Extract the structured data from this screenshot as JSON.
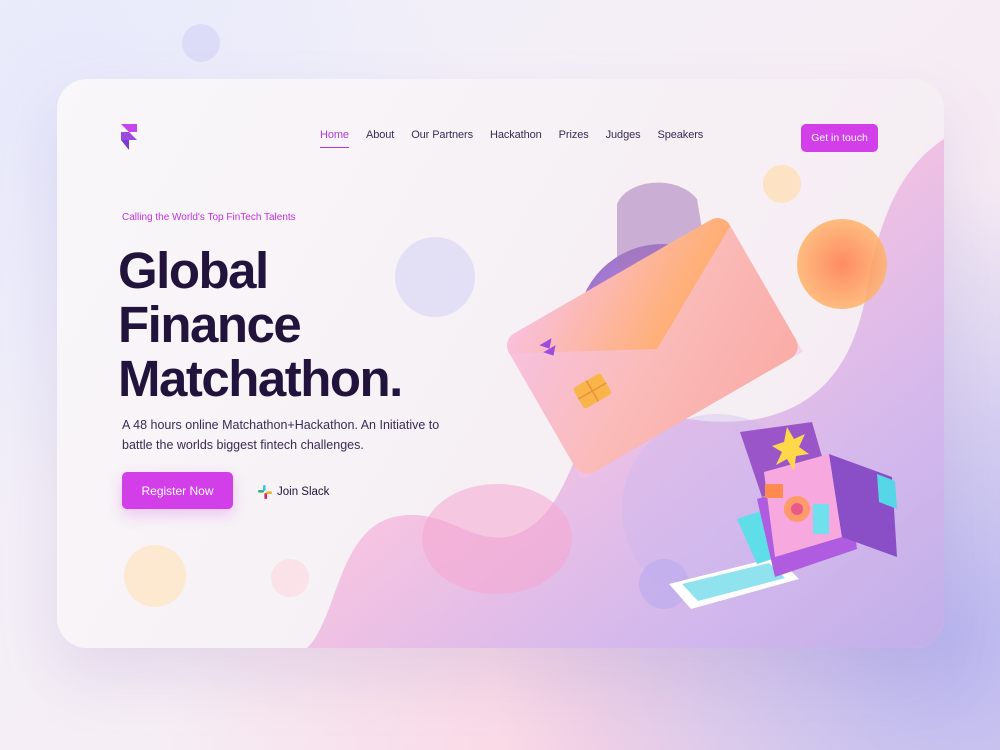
{
  "brand": {
    "logo_icon": "framer-logo-icon",
    "accent": "#d23fe8",
    "headline_color": "#22133d"
  },
  "nav": {
    "items": [
      {
        "label": "Home",
        "active": true
      },
      {
        "label": "About",
        "active": false
      },
      {
        "label": "Our Partners",
        "active": false
      },
      {
        "label": "Hackathon",
        "active": false
      },
      {
        "label": "Prizes",
        "active": false
      },
      {
        "label": "Judges",
        "active": false
      },
      {
        "label": "Speakers",
        "active": false
      }
    ],
    "cta_label": "Get in touch"
  },
  "hero": {
    "eyebrow": "Calling the World's Top FinTech Talents",
    "headline": [
      "Global",
      "Finance",
      "Matchathon."
    ],
    "description": "A 48 hours online Matchathon+Hackathon. An Initiative to battle the worlds biggest fintech challenges.",
    "primary_cta": "Register Now",
    "secondary_cta": {
      "label": "Join Slack",
      "icon": "slack-icon"
    }
  },
  "illustration": {
    "card_icon": "credit-card-illustration",
    "camera_icon": "instant-camera-illustration"
  }
}
